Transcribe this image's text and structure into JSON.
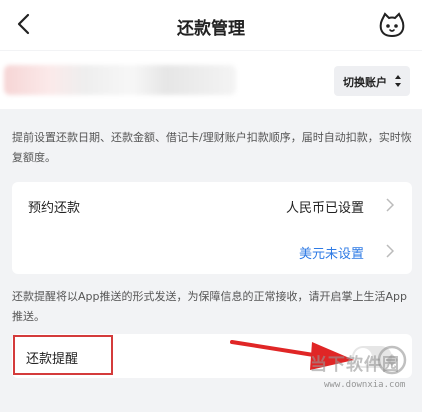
{
  "nav": {
    "title": "还款管理"
  },
  "account": {
    "switch_label": "切换账户"
  },
  "notes": {
    "top": "提前设置还款日期、还款金额、借记卡/理财账户扣款顺序，届时自动扣款，实时恢复额度。",
    "reminder": "还款提醒将以App推送的形式发送，为保障信息的正常接收，请开启掌上生活App推送。"
  },
  "reservation": {
    "label": "预约还款",
    "rmb_status": "人民币已设置",
    "usd_status": "美元未设置"
  },
  "reminder": {
    "label": "还款提醒",
    "enabled": false
  },
  "watermark": {
    "text": "当下软件园",
    "url": "www.downxia.com"
  },
  "colors": {
    "accent_blue": "#2f7be5",
    "highlight_red": "#d43b3b",
    "background": "#f2f3f5"
  }
}
